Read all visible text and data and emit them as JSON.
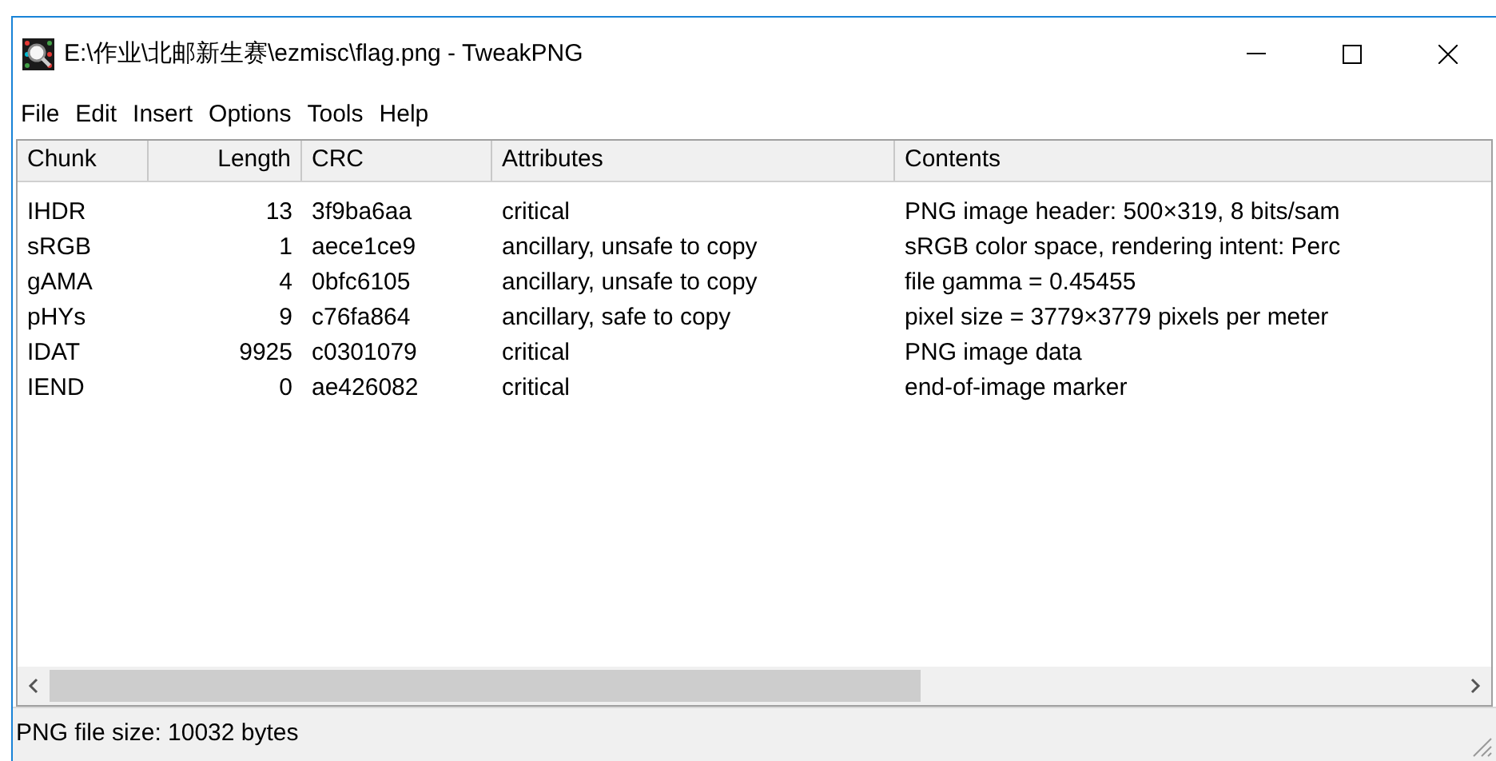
{
  "window": {
    "title": "E:\\作业\\北邮新生赛\\ezmisc\\flag.png - TweakPNG"
  },
  "menu": [
    "File",
    "Edit",
    "Insert",
    "Options",
    "Tools",
    "Help"
  ],
  "table": {
    "columns": [
      "Chunk",
      "Length",
      "CRC",
      "Attributes",
      "Contents"
    ],
    "rows": [
      [
        "IHDR",
        "13",
        "3f9ba6aa",
        "critical",
        "PNG image header: 500×319, 8 bits/sam"
      ],
      [
        "sRGB",
        "1",
        "aece1ce9",
        "ancillary, unsafe to copy",
        "sRGB color space, rendering intent: Perc"
      ],
      [
        "gAMA",
        "4",
        "0bfc6105",
        "ancillary, unsafe to copy",
        "file gamma = 0.45455"
      ],
      [
        "pHYs",
        "9",
        "c76fa864",
        "ancillary, safe to copy",
        "pixel size = 3779×3779 pixels per meter"
      ],
      [
        "IDAT",
        "9925",
        "c0301079",
        "critical",
        "PNG image data"
      ],
      [
        "IEND",
        "0",
        "ae426082",
        "critical",
        "end-of-image marker"
      ]
    ]
  },
  "status_bar": "PNG file size: 10032 bytes"
}
